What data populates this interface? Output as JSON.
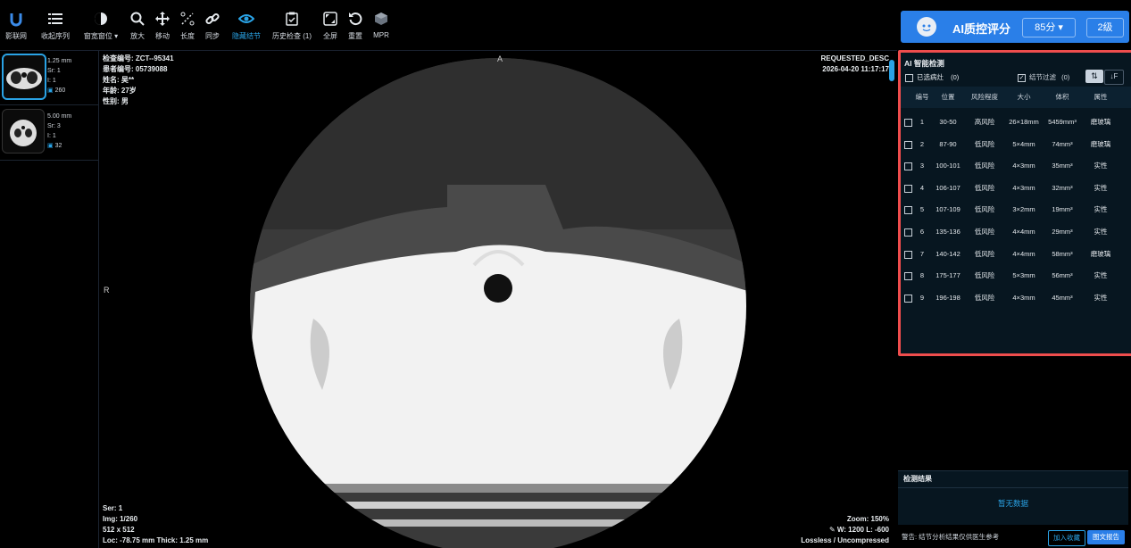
{
  "toolbar": {
    "items": [
      {
        "label": "影联网",
        "icon": "logo-icon"
      },
      {
        "label": "收起序列",
        "icon": "list-icon"
      },
      {
        "label": "窗宽窗位 ▾",
        "icon": "contrast-icon"
      },
      {
        "label": "放大",
        "icon": "zoom-icon"
      },
      {
        "label": "移动",
        "icon": "move-icon"
      },
      {
        "label": "长度",
        "icon": "ruler-icon"
      },
      {
        "label": "同步",
        "icon": "link-icon"
      },
      {
        "label": "隐藏结节",
        "icon": "eye-icon"
      },
      {
        "label": "历史检查 (1)",
        "icon": "clipboard-icon"
      },
      {
        "label": "全屏",
        "icon": "fullscreen-icon"
      },
      {
        "label": "重置",
        "icon": "reset-icon"
      },
      {
        "label": "MPR",
        "icon": "cube-icon"
      }
    ]
  },
  "series": [
    {
      "thickness": "1.25 mm",
      "sr": "Sr: 1",
      "i": "I: 1",
      "count": "260"
    },
    {
      "thickness": "5.00 mm",
      "sr": "Sr: 3",
      "i": "I: 1",
      "count": "32"
    }
  ],
  "viewer": {
    "top_left": [
      "检查编号: ZCT--95341",
      "患者编号: 05739088",
      "姓名: 吴**",
      "年龄: 27岁",
      "性别: 男"
    ],
    "top_right": [
      "REQUESTED_DESC",
      "2026-04-20 11:17:17"
    ],
    "orientation_top": "A",
    "orientation_left": "R",
    "bottom_left": [
      "Ser: 1",
      "Img: 1/260",
      "512 x 512",
      "Loc: -78.75 mm Thick: 1.25 mm"
    ],
    "bottom_right": [
      "Zoom: 150%",
      "W: 1200 L: -600",
      "Lossless / Uncompressed"
    ]
  },
  "ai_header": {
    "title": "AI质控评分",
    "score": "85分 ▾",
    "grade": "2级"
  },
  "ai_panel": {
    "title": "AI 智能检测",
    "selected_label": "已选病灶",
    "selected_count": "(0)",
    "filter_label": "结节过滤",
    "filter_count": "(0)",
    "columns": [
      "编号",
      "位置",
      "风险程度",
      "大小",
      "体积",
      "属性"
    ],
    "rows": [
      [
        "1",
        "30-50",
        "高风险",
        "26×18mm",
        "5459mm³",
        "磨玻璃"
      ],
      [
        "2",
        "87-90",
        "低风险",
        "5×4mm",
        "74mm³",
        "磨玻璃"
      ],
      [
        "3",
        "100-101",
        "低风险",
        "4×3mm",
        "35mm³",
        "实性"
      ],
      [
        "4",
        "106-107",
        "低风险",
        "4×3mm",
        "32mm³",
        "实性"
      ],
      [
        "5",
        "107-109",
        "低风险",
        "3×2mm",
        "19mm³",
        "实性"
      ],
      [
        "6",
        "135-136",
        "低风险",
        "4×4mm",
        "29mm³",
        "实性"
      ],
      [
        "7",
        "140-142",
        "低风险",
        "4×4mm",
        "58mm³",
        "磨玻璃"
      ],
      [
        "8",
        "175-177",
        "低风险",
        "5×3mm",
        "56mm³",
        "实性"
      ],
      [
        "9",
        "196-198",
        "低风险",
        "4×3mm",
        "45mm³",
        "实性"
      ]
    ]
  },
  "result": {
    "title": "检测结果",
    "empty": "暂无数据"
  },
  "footer": {
    "warning": "警告: 结节分析结果仅供医生参考",
    "add_btn": "加入收藏",
    "report_btn": "图文报告"
  },
  "colors": {
    "accent": "#2aa3e6",
    "header": "#2a7fe8",
    "highlight": "#ef4d4d"
  }
}
